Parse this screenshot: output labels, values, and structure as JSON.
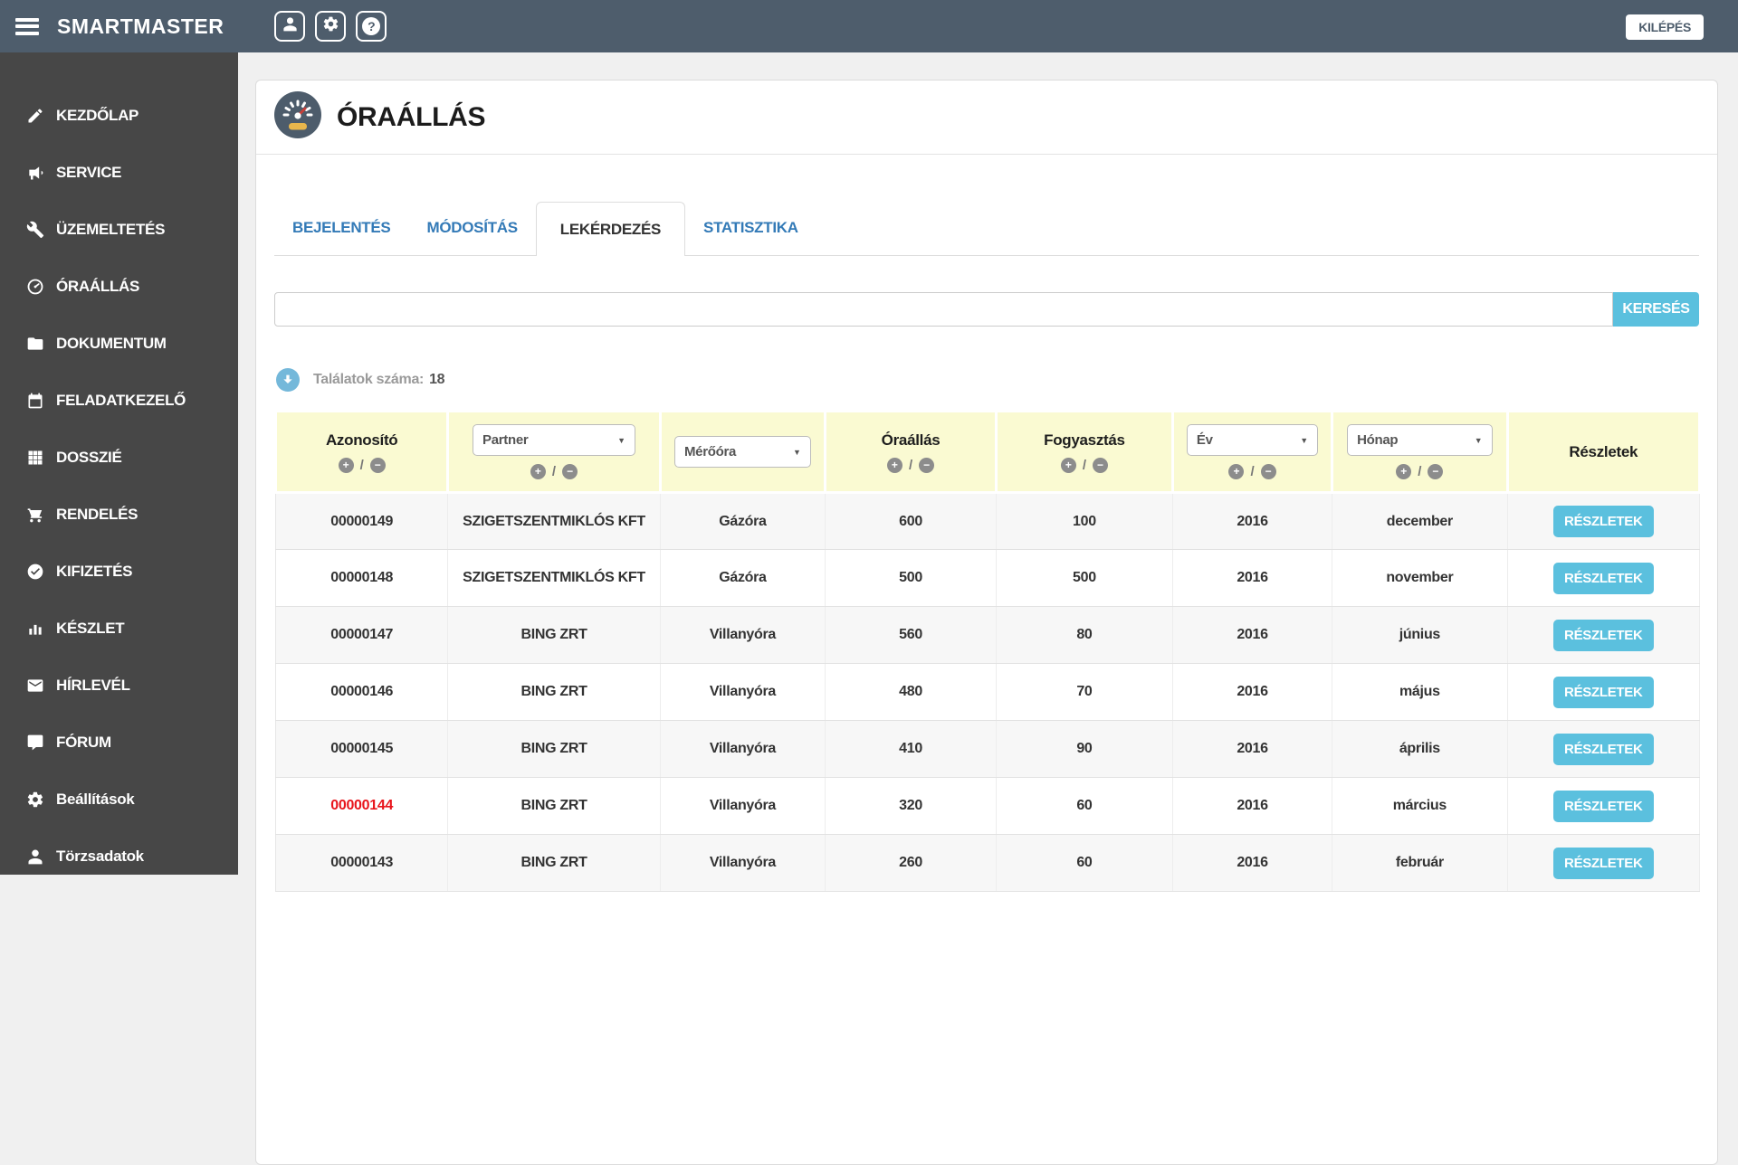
{
  "topbar": {
    "title": "SMARTMASTER",
    "menu_icon": "hamburger-icon",
    "action_icons": [
      "user-icon",
      "gear-icon",
      "help-icon"
    ],
    "logout_label": "KILÉPÉS"
  },
  "sidebar": {
    "items": [
      {
        "label": "KEZDŐLAP",
        "icon": "edit-icon"
      },
      {
        "label": "SERVICE",
        "icon": "megaphone-icon"
      },
      {
        "label": "ÜZEMELTETÉS",
        "icon": "wrench-icon"
      },
      {
        "label": "ÓRAÁLLÁS",
        "icon": "gauge-icon"
      },
      {
        "label": "DOKUMENTUM",
        "icon": "folder-icon"
      },
      {
        "label": "FELADATKEZELŐ",
        "icon": "calendar-icon"
      },
      {
        "label": "DOSSZIÉ",
        "icon": "grid-icon"
      },
      {
        "label": "RENDELÉS",
        "icon": "cart-icon"
      },
      {
        "label": "KIFIZETÉS",
        "icon": "check-circle-icon"
      },
      {
        "label": "KÉSZLET",
        "icon": "bar-chart-icon"
      },
      {
        "label": "HÍRLEVÉL",
        "icon": "envelope-icon"
      },
      {
        "label": "FÓRUM",
        "icon": "comment-icon"
      },
      {
        "label": "Beállítások",
        "icon": "gear-icon"
      },
      {
        "label": "Törzsadatok",
        "icon": "user-icon"
      }
    ]
  },
  "page": {
    "title": "ÓRAÁLLÁS",
    "title_icon": "gauge-icon",
    "tabs": [
      {
        "label": "BEJELENTÉS",
        "active": false
      },
      {
        "label": "MÓDOSÍTÁS",
        "active": false
      },
      {
        "label": "LEKÉRDEZÉS",
        "active": true
      },
      {
        "label": "STATISZTIKA",
        "active": false
      }
    ],
    "search": {
      "value": "",
      "placeholder": "",
      "button_label": "KERESÉS"
    },
    "results": {
      "label": "Találatok száma:",
      "count": "18",
      "icon": "arrow-down-circle-icon"
    }
  },
  "table": {
    "sort_separator": "/",
    "columns": [
      {
        "key": "id",
        "label": "Azonosító",
        "type": "label",
        "sort": true,
        "width": 12.1
      },
      {
        "key": "partner",
        "label": "Partner",
        "type": "select",
        "sort": true,
        "width": 14.9
      },
      {
        "key": "meter",
        "label": "Mérőóra",
        "type": "select",
        "sort": false,
        "width": 11.6
      },
      {
        "key": "reading",
        "label": "Óraállás",
        "type": "label",
        "sort": true,
        "width": 12.0
      },
      {
        "key": "consumption",
        "label": "Fogyasztás",
        "type": "label",
        "sort": true,
        "width": 12.4
      },
      {
        "key": "year",
        "label": "Év",
        "type": "select",
        "sort": true,
        "width": 11.2
      },
      {
        "key": "month",
        "label": "Hónap",
        "type": "select",
        "sort": true,
        "width": 12.3
      },
      {
        "key": "details",
        "label": "Részletek",
        "type": "label",
        "sort": false,
        "width": 13.5
      }
    ],
    "details_button_label": "RÉSZLETEK",
    "rows": [
      {
        "id": "00000149",
        "partner": "SZIGETSZENTMIKLÓS KFT",
        "meter": "Gázóra",
        "reading": "600",
        "consumption": "100",
        "year": "2016",
        "month": "december",
        "highlight": false
      },
      {
        "id": "00000148",
        "partner": "SZIGETSZENTMIKLÓS KFT",
        "meter": "Gázóra",
        "reading": "500",
        "consumption": "500",
        "year": "2016",
        "month": "november",
        "highlight": false
      },
      {
        "id": "00000147",
        "partner": "BING ZRT",
        "meter": "Villanyóra",
        "reading": "560",
        "consumption": "80",
        "year": "2016",
        "month": "június",
        "highlight": false
      },
      {
        "id": "00000146",
        "partner": "BING ZRT",
        "meter": "Villanyóra",
        "reading": "480",
        "consumption": "70",
        "year": "2016",
        "month": "május",
        "highlight": false
      },
      {
        "id": "00000145",
        "partner": "BING ZRT",
        "meter": "Villanyóra",
        "reading": "410",
        "consumption": "90",
        "year": "2016",
        "month": "április",
        "highlight": false
      },
      {
        "id": "00000144",
        "partner": "BING ZRT",
        "meter": "Villanyóra",
        "reading": "320",
        "consumption": "60",
        "year": "2016",
        "month": "március",
        "highlight": true
      },
      {
        "id": "00000143",
        "partner": "BING ZRT",
        "meter": "Villanyóra",
        "reading": "260",
        "consumption": "60",
        "year": "2016",
        "month": "február",
        "highlight": false
      }
    ]
  },
  "colors": {
    "topbar": "#4e5d6c",
    "sidebar": "#474747",
    "accent_blue": "#5bc0de",
    "tab_link_blue": "#337ab7",
    "table_header_yellow": "#fafad2",
    "highlight_red": "#e8151c"
  }
}
